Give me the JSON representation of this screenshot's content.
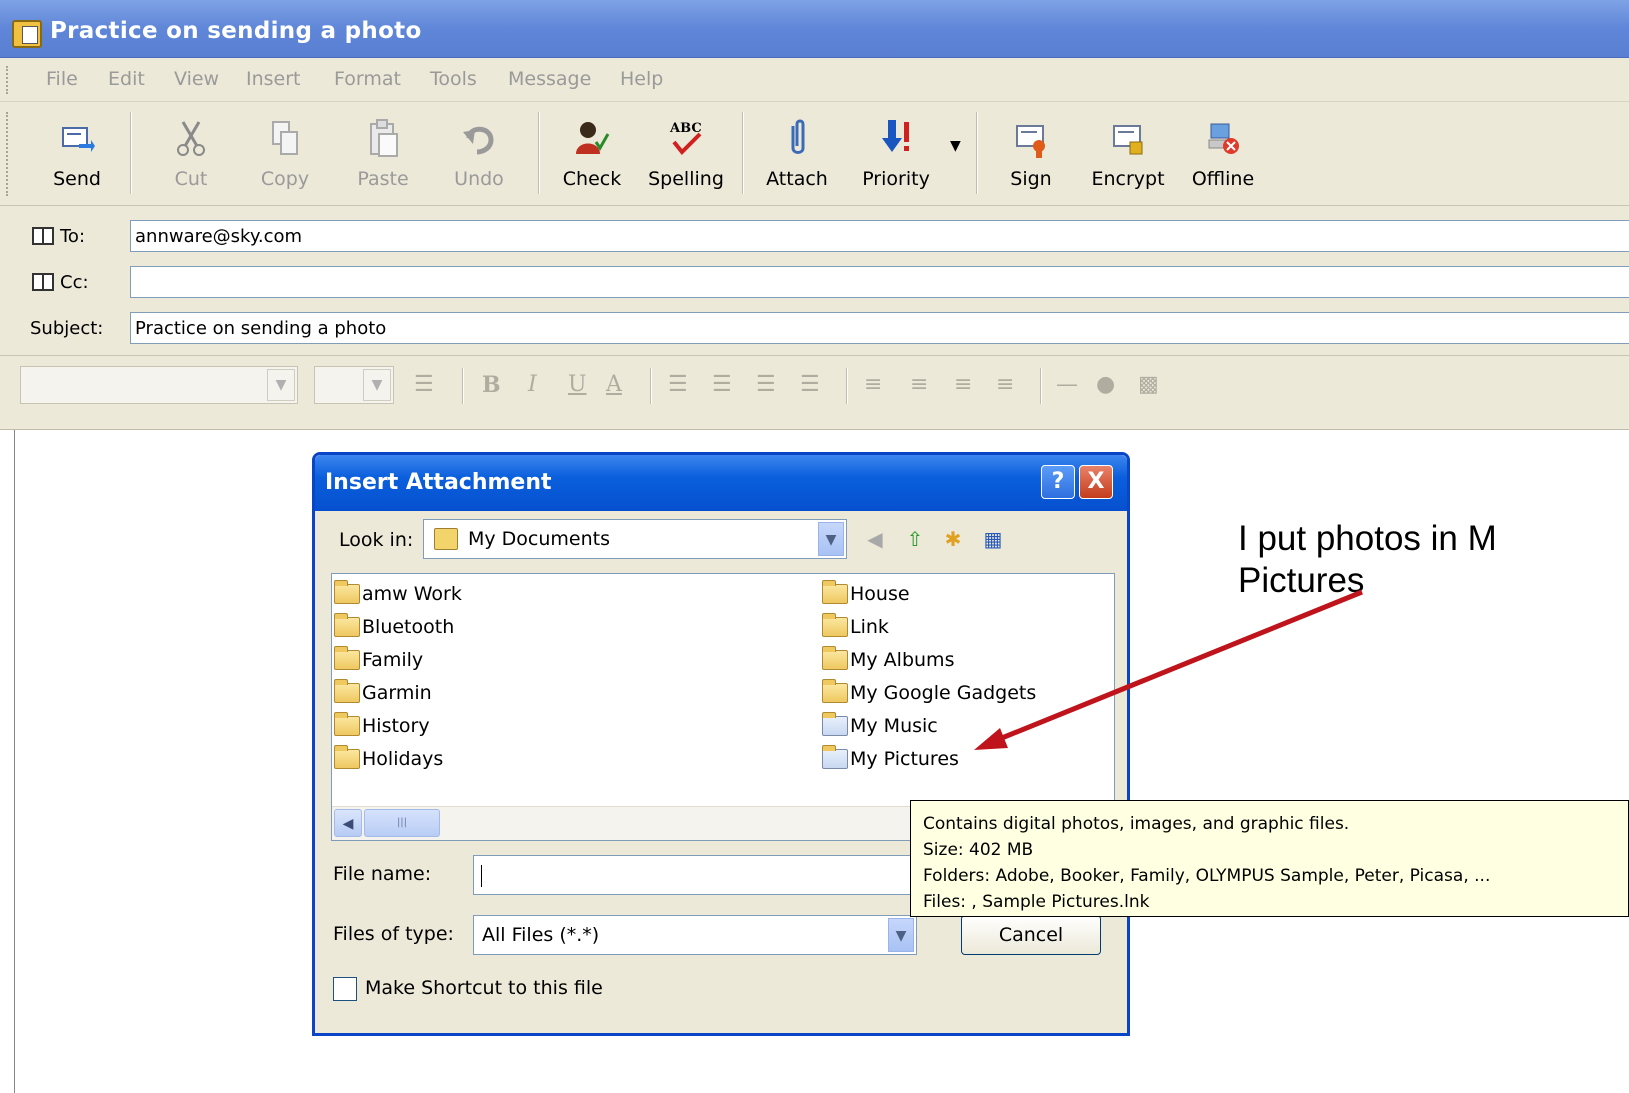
{
  "window": {
    "title": "Practice on sending a photo"
  },
  "menu": [
    "File",
    "Edit",
    "View",
    "Insert",
    "Format",
    "Tools",
    "Message",
    "Help"
  ],
  "toolbar": [
    {
      "label": "Send",
      "icon": "send-icon",
      "enabled": true
    },
    {
      "label": "Cut",
      "icon": "scissors-icon",
      "enabled": false
    },
    {
      "label": "Copy",
      "icon": "copy-icon",
      "enabled": false
    },
    {
      "label": "Paste",
      "icon": "paste-icon",
      "enabled": false
    },
    {
      "label": "Undo",
      "icon": "undo-icon",
      "enabled": false
    },
    {
      "label": "Check",
      "icon": "check-names-icon",
      "enabled": true
    },
    {
      "label": "Spelling",
      "icon": "spelling-icon",
      "enabled": true
    },
    {
      "label": "Attach",
      "icon": "paperclip-icon",
      "enabled": true
    },
    {
      "label": "Priority",
      "icon": "priority-icon",
      "enabled": true
    },
    {
      "label": "Sign",
      "icon": "sign-icon",
      "enabled": true
    },
    {
      "label": "Encrypt",
      "icon": "encrypt-icon",
      "enabled": true
    },
    {
      "label": "Offline",
      "icon": "offline-icon",
      "enabled": true
    }
  ],
  "fields": {
    "to_label": "To:",
    "to_value": "annware@sky.com",
    "cc_label": "Cc:",
    "cc_value": "",
    "subject_label": "Subject:",
    "subject_value": "Practice on sending a photo"
  },
  "format_bar": {
    "bold": "B",
    "italic": "I",
    "underline": "U",
    "font_color": "A"
  },
  "dialog": {
    "title": "Insert Attachment",
    "help": "?",
    "close": "X",
    "look_in_label": "Look in:",
    "look_in_value": "My Documents",
    "items_left": [
      "amw Work",
      "Bluetooth",
      "Family",
      "Garmin",
      "History",
      "Holidays"
    ],
    "items_right": [
      "House",
      "Link",
      "My Albums",
      "My Google Gadgets",
      "My Music",
      "My Pictures"
    ],
    "file_name_label": "File name:",
    "file_name_value": "",
    "file_type_label": "Files of type:",
    "file_type_value": "All Files (*.*)",
    "cancel_label": "Cancel",
    "shortcut_label": "Make Shortcut to this file"
  },
  "tooltip": [
    "Contains digital photos, images, and graphic files.",
    "Size: 402 MB",
    "Folders: Adobe, Booker, Family, OLYMPUS Sample, Peter, Picasa, ...",
    "Files: , Sample Pictures.lnk"
  ],
  "annotation": {
    "line1": "I put photos in M",
    "line2": "Pictures",
    "arrow_color": "#c0141c"
  }
}
